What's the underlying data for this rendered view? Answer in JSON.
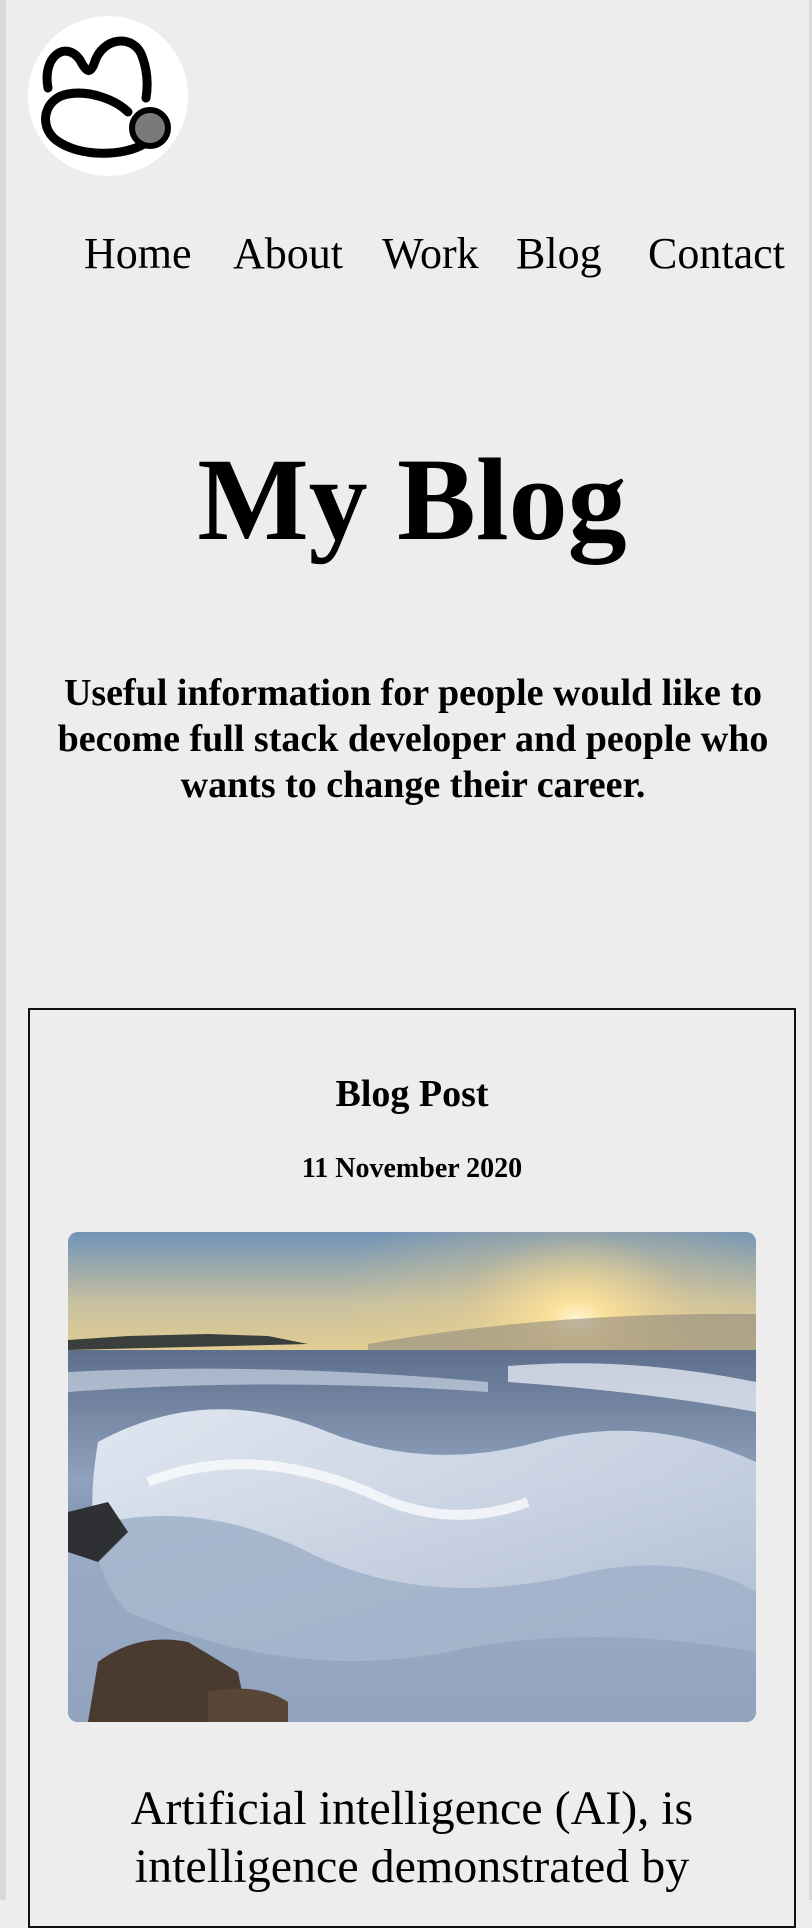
{
  "nav": {
    "items": [
      {
        "label": "Home"
      },
      {
        "label": "About"
      },
      {
        "label": "Work"
      },
      {
        "label": "Blog"
      },
      {
        "label": "Contact"
      }
    ]
  },
  "hero": {
    "title": "My Blog",
    "subtitle": "Useful information for people would like to become full stack developer and people who wants to change their career."
  },
  "post": {
    "title": "Blog Post",
    "date": "11 November 2020",
    "image_icon": "ocean-waves-sunrise-photo",
    "excerpt": "Artificial intelligence (AI), is intelligence demonstrated by"
  },
  "colors": {
    "background": "#ededed",
    "text": "#000000",
    "card_border": "#111111"
  }
}
